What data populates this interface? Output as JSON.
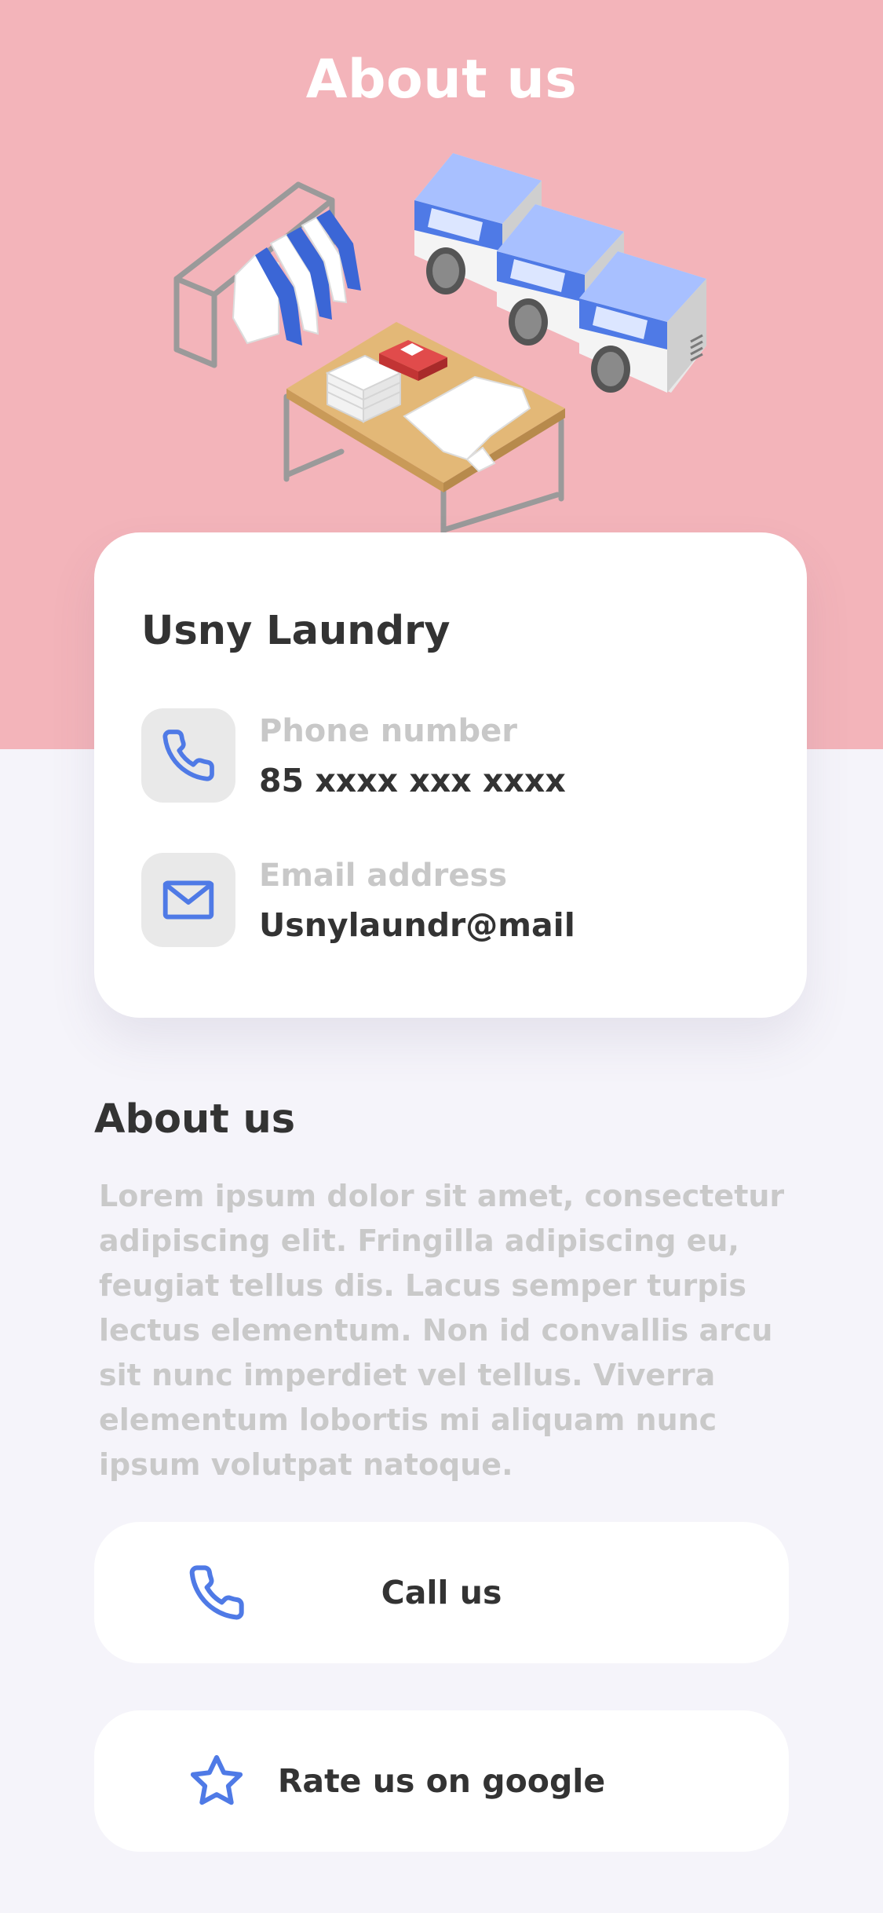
{
  "header": {
    "title": "About us",
    "background_color": "#f3b4ba",
    "illustration": "laundry-room-illustration"
  },
  "card": {
    "company_name": "Usny Laundry",
    "phone": {
      "label": "Phone number",
      "value": "85 xxxx xxx xxxx",
      "icon": "phone-icon"
    },
    "email": {
      "label": "Email address",
      "value": "Usnylaundr@mail",
      "icon": "mail-icon"
    }
  },
  "about": {
    "title": "About us",
    "body": "Lorem ipsum dolor sit amet, consectetur adipiscing elit. Fringilla adipiscing eu, feugiat tellus dis. Lacus semper turpis lectus elementum. Non id convallis arcu sit nunc imperdiet vel tellus. Viverra elementum lobortis mi aliquam nunc ipsum volutpat natoque."
  },
  "actions": {
    "call": {
      "label": "Call us",
      "icon": "phone-icon"
    },
    "rate": {
      "label": "Rate us on google",
      "icon": "star-icon"
    }
  },
  "colors": {
    "accent": "#4f7ae6",
    "text_dark": "#333333",
    "text_muted": "#c8c8c8",
    "page_background": "#f5f4fa"
  }
}
